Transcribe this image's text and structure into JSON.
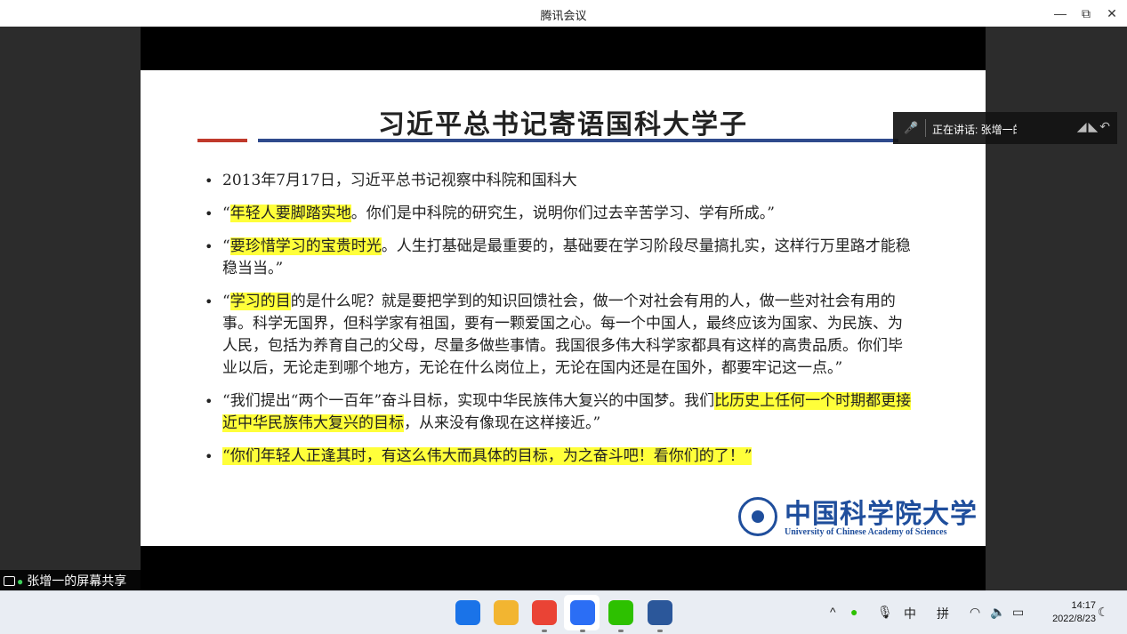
{
  "window": {
    "title": "腾讯会议",
    "minimize": "—",
    "restore": "⧉",
    "close": "✕"
  },
  "slide": {
    "title": "习近平总书记寄语国科大学子",
    "bullets": [
      {
        "parts": [
          {
            "text": "2013年7月17日，习近平总书记视察中科院和国科大",
            "hl": false
          }
        ]
      },
      {
        "parts": [
          {
            "text": "“",
            "hl": false
          },
          {
            "text": "年轻人要脚踏实地",
            "hl": true
          },
          {
            "text": "。你们是中科院的研究生，说明你们过去辛苦学习、学有所成。”",
            "hl": false
          }
        ]
      },
      {
        "parts": [
          {
            "text": "“",
            "hl": false
          },
          {
            "text": "要珍惜学习的宝贵时光",
            "hl": true
          },
          {
            "text": "。人生打基础是最重要的，基础要在学习阶段尽量搞扎实，这样行万里路才能稳稳当当。”",
            "hl": false
          }
        ]
      },
      {
        "parts": [
          {
            "text": "“",
            "hl": false
          },
          {
            "text": "学习的目",
            "hl": true
          },
          {
            "text": "的是什么呢？就是要把学到的知识回馈社会，做一个对社会有用的人，做一些对社会有用的事。科学无国界，但科学家有祖国，要有一颗爱国之心。每一个中国人，最终应该为国家、为民族、为人民，包括为养育自己的父母，尽量多做些事情。我国很多伟大科学家都具有这样的高贵品质。你们毕业以后，无论走到哪个地方，无论在什么岗位上，无论在国内还是在国外，都要牢记这一点。”",
            "hl": false
          }
        ]
      },
      {
        "parts": [
          {
            "text": "“我们提出“两个一百年”奋斗目标，实现中华民族伟大复兴的中国梦。我们",
            "hl": false
          },
          {
            "text": "比历史上任何一个时期都更接近中华民族伟大复兴的目标",
            "hl": true
          },
          {
            "text": "，从来没有像现在这样接近。”",
            "hl": false
          }
        ]
      },
      {
        "parts": [
          {
            "text": "“你们年轻人正逢其时，有这么伟大而具体的目标，为之奋斗吧！看你们的了！”",
            "hl": true
          }
        ]
      }
    ],
    "logo_cn": "中国科学院大学",
    "logo_en": "University of Chinese Academy of Sciences"
  },
  "speaker": {
    "label": "正在讲话: 张增一的",
    "icons": "◢◣↶"
  },
  "share_label": "张增一的屏幕共享",
  "taskbar": {
    "apps": [
      {
        "name": "windows-start",
        "color": "#1a73e8"
      },
      {
        "name": "file-explorer",
        "color": "#f2b531"
      },
      {
        "name": "chrome",
        "color": "#ea4335"
      },
      {
        "name": "tencent-meeting",
        "color": "#2b6ef5"
      },
      {
        "name": "wechat",
        "color": "#2dc100"
      },
      {
        "name": "word",
        "color": "#2b579a"
      }
    ],
    "tray": {
      "chevron": "^",
      "ime_cn": "中",
      "ime_pinyin": "拼"
    },
    "time": "14:17",
    "date": "2022/8/23"
  }
}
